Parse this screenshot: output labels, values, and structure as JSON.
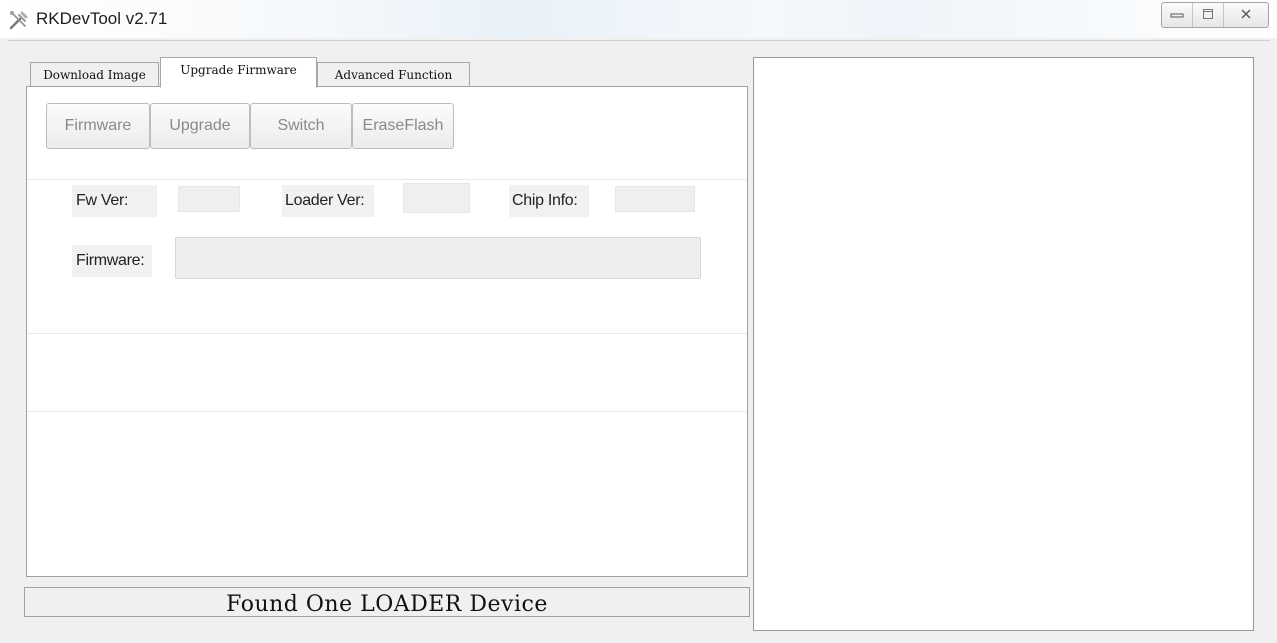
{
  "window": {
    "title": "RKDevTool v2.71",
    "controls": {
      "minimize_icon": "minimize-icon",
      "maximize_icon": "maximize-icon",
      "close_icon": "close-icon"
    }
  },
  "tabs": [
    {
      "label": "Download Image",
      "active": false
    },
    {
      "label": "Upgrade Firmware",
      "active": true
    },
    {
      "label": "Advanced Function",
      "active": false
    }
  ],
  "toolbar": {
    "firmware_label": "Firmware",
    "upgrade_label": "Upgrade",
    "switch_label": "Switch",
    "eraseflash_label": "EraseFlash"
  },
  "info": {
    "fw_ver_label": "Fw Ver:",
    "fw_ver_value": "",
    "loader_ver_label": "Loader Ver:",
    "loader_ver_value": "",
    "chip_info_label": "Chip Info:",
    "chip_info_value": "",
    "firmware_label": "Firmware:",
    "firmware_path": ""
  },
  "status": {
    "text": "Found One LOADER Device"
  },
  "log": {
    "content": ""
  },
  "colors": {
    "window_bg": "#f0f0f0",
    "panel_bg": "#ffffff",
    "disabled_text": "#8a8a8a"
  }
}
